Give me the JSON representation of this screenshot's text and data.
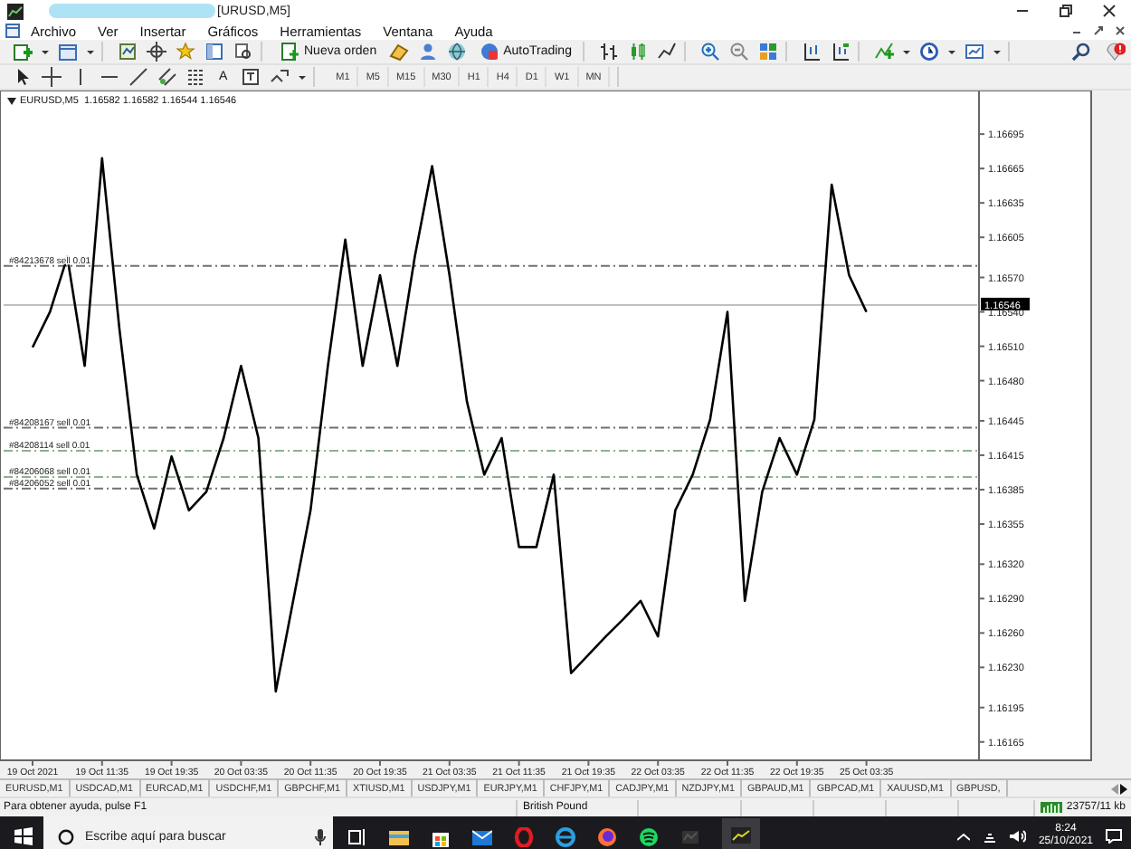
{
  "window": {
    "title": "[URUSD,M5]"
  },
  "menu": [
    "Archivo",
    "Ver",
    "Insertar",
    "Gráficos",
    "Herramientas",
    "Ventana",
    "Ayuda"
  ],
  "toolbar": {
    "new_order": "Nueva orden",
    "autotrading": "AutoTrading",
    "text_tool": "A",
    "timeframes": [
      "M1",
      "M5",
      "M15",
      "M30",
      "H1",
      "H4",
      "D1",
      "W1",
      "MN"
    ]
  },
  "chart": {
    "header": "EURUSD,M5  1.16582 1.16582 1.16544 1.16546",
    "chart_data": {
      "type": "line",
      "values": [
        1.16509,
        1.1654,
        1.16588,
        1.16493,
        1.16674,
        1.16525,
        1.16398,
        1.16351,
        1.16414,
        1.16367,
        1.16383,
        1.1643,
        1.16493,
        1.1643,
        1.16209,
        1.16288,
        1.16367,
        1.16493,
        1.16603,
        1.16493,
        1.16572,
        1.16493,
        1.16588,
        1.16667,
        1.16572,
        1.16462,
        1.16398,
        1.1643,
        1.16335,
        1.16335,
        1.16398,
        1.16225,
        1.16241,
        1.16257,
        1.16272,
        1.16288,
        1.16257,
        1.16367,
        1.16398,
        1.16446,
        1.1654,
        1.16288,
        1.16383,
        1.1643,
        1.16398,
        1.16446,
        1.16651,
        1.16572,
        1.1654
      ],
      "categories": [
        "19 Oct 2021",
        null,
        null,
        null,
        "19 Oct 11:35",
        null,
        null,
        null,
        "19 Oct 19:35",
        null,
        null,
        null,
        "20 Oct 03:35",
        null,
        null,
        null,
        "20 Oct 11:35",
        null,
        null,
        null,
        "20 Oct 19:35",
        null,
        null,
        null,
        "21 Oct 03:35",
        null,
        null,
        null,
        "21 Oct 11:35",
        null,
        null,
        null,
        "21 Oct 19:35",
        null,
        null,
        null,
        "22 Oct 03:35",
        null,
        null,
        null,
        "22 Oct 11:35",
        null,
        null,
        null,
        "22 Oct 19:35",
        null,
        null,
        null,
        "25 Oct 03:35"
      ],
      "ylim": [
        1.16149,
        1.16733
      ],
      "yticks": [
        1.16695,
        1.16665,
        1.16635,
        1.16605,
        {
          "value": 1.1657,
          "label": "1.16570"
        },
        {
          "value": 1.1654,
          "label": "1.16540"
        },
        {
          "value": 1.1651,
          "label": "1.16510"
        },
        {
          "value": 1.1648,
          "label": "1.16480"
        },
        1.16445,
        1.16415,
        1.16385,
        1.16355,
        {
          "value": 1.1632,
          "label": "1.16320"
        },
        {
          "value": 1.1629,
          "label": "1.16290"
        },
        {
          "value": 1.1626,
          "label": "1.16260"
        },
        {
          "value": 1.1623,
          "label": "1.16230"
        },
        1.16195,
        1.16165
      ],
      "ref_lines": [
        {
          "axis": "y",
          "value": 1.1658,
          "label": "#84213678 sell 0.01",
          "color": "#707070"
        },
        {
          "axis": "y",
          "value": 1.16439,
          "label": "#84208167 sell 0.01",
          "color": "#707070"
        },
        {
          "axis": "y",
          "value": 1.16419,
          "label": "#84208114 sell 0.01",
          "color": "#8fb08f"
        },
        {
          "axis": "y",
          "value": 1.16396,
          "label": "#84206068 sell 0.01",
          "color": "#8fb08f"
        },
        {
          "axis": "y",
          "value": 1.16386,
          "label": "#84206052 sell 0.01",
          "color": "#707070"
        },
        {
          "axis": "y",
          "value": 1.16546,
          "label": "1.16546",
          "color": "#c0c0c0"
        }
      ]
    }
  },
  "tabs": [
    {
      "label": "EURUSD,M1",
      "selected": false
    },
    {
      "label": "USDCAD,M1",
      "selected": false
    },
    {
      "label": "EURCAD,M1",
      "selected": false
    },
    {
      "label": "USDCHF,M1",
      "selected": false
    },
    {
      "label": "GBPCHF,M1",
      "selected": false
    },
    {
      "label": "XTIUSD,M1",
      "selected": false
    },
    {
      "label": "USDJPY,M1",
      "selected": false
    },
    {
      "label": "EURJPY,M1",
      "selected": false
    },
    {
      "label": "CHFJPY,M1",
      "selected": false
    },
    {
      "label": "CADJPY,M1",
      "selected": false
    },
    {
      "label": "NZDJPY,M1",
      "selected": false
    },
    {
      "label": "GBPAUD,M1",
      "selected": false
    },
    {
      "label": "GBPCAD,M1",
      "selected": false
    },
    {
      "label": "XAUUSD,M1",
      "selected": false
    },
    {
      "label": "GBPUSD,",
      "selected": false
    }
  ],
  "status_bar": {
    "help": "Para obtener ayuda, pulse F1",
    "profile": "British Pound",
    "traffic": "23757/11 kb"
  },
  "taskbar": {
    "search_placeholder": "Escribe aquí para buscar",
    "time": "8:24",
    "date": "25/10/2021"
  }
}
